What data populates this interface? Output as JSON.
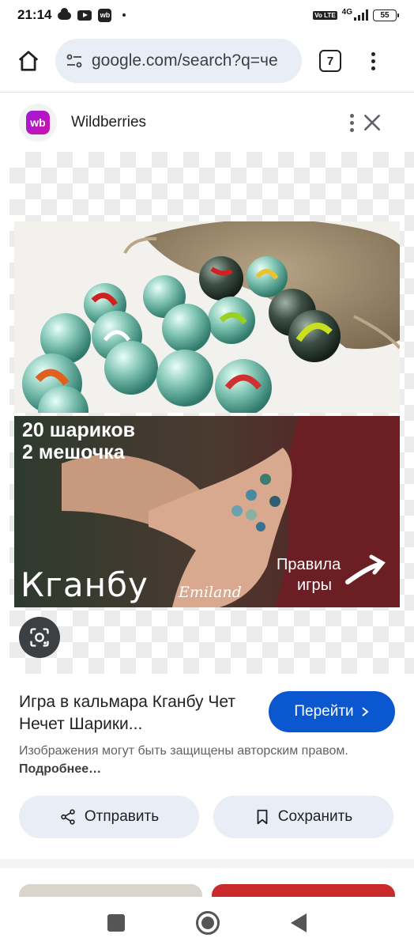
{
  "status_bar": {
    "time": "21:14",
    "network": "4G",
    "volte": "Vo LTE",
    "battery": "55"
  },
  "browser": {
    "url": "google.com/search?q=че",
    "tab_count": "7"
  },
  "site": {
    "logo_text": "wb",
    "name": "Wildberries"
  },
  "image": {
    "overlay_line1": "20 шариков",
    "overlay_line2": "2 мешочка",
    "overlay_title": "Кганбу",
    "overlay_brand": "Emiland",
    "overlay_rules_line1": "Правила",
    "overlay_rules_line2": "игры"
  },
  "result": {
    "title": "Игра в кальмара Кганбу Чет Нечет Шарики...",
    "visit_label": "Перейти",
    "copyright_text": "Изображения могут быть защищены авторским правом.",
    "learn_more": "Подробнее…",
    "share_label": "Отправить",
    "save_label": "Сохранить"
  },
  "colors": {
    "accent": "#0b57d0",
    "pill_bg": "#e9eef6",
    "brand": "#cb11ab"
  }
}
